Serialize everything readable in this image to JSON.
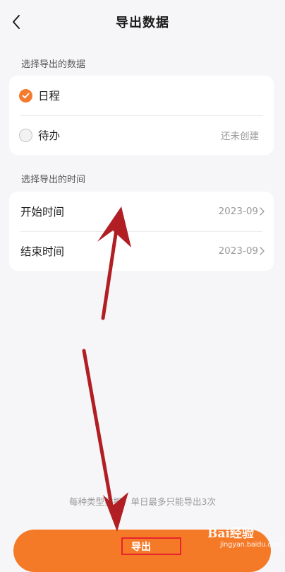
{
  "header": {
    "title": "导出数据",
    "back_icon": "chevron-left-icon"
  },
  "data_section": {
    "label": "选择导出的数据",
    "items": [
      {
        "label": "日程",
        "checked": true,
        "note": ""
      },
      {
        "label": "待办",
        "checked": false,
        "note": "还未创建"
      }
    ]
  },
  "time_section": {
    "label": "选择导出的时间",
    "items": [
      {
        "label": "开始时间",
        "value": "2023-09"
      },
      {
        "label": "结束时间",
        "value": "2023-09"
      }
    ]
  },
  "footnote": "每种类型数据，单日最多只能导出3次",
  "export_button": {
    "label": "导出"
  },
  "watermark": {
    "logo": "Bai经验",
    "url": "jingyan.baidu.com"
  },
  "colors": {
    "accent": "#f57a28",
    "annotation": "#b11f24",
    "highlight_box": "#e8232e"
  }
}
